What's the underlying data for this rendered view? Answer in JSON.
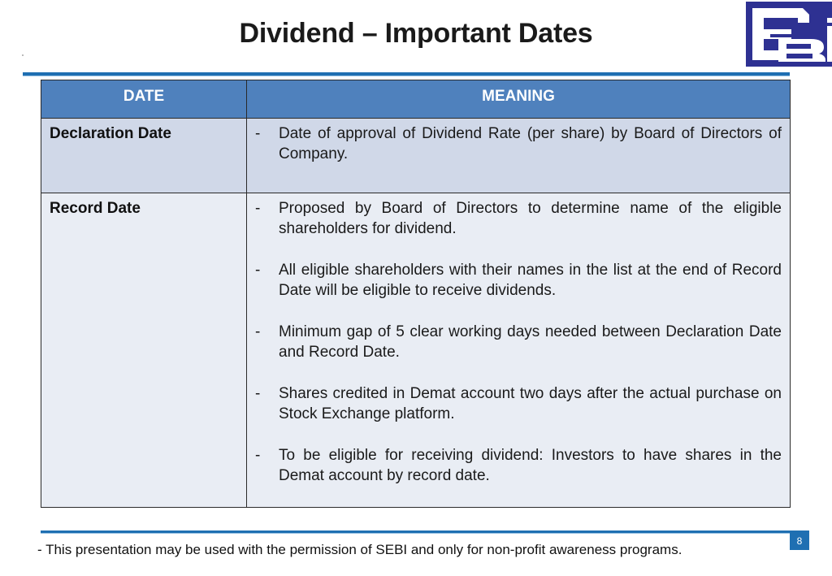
{
  "slide": {
    "title": "Dividend – Important Dates",
    "logo_text": "SEBI",
    "brand_color": "#1f6fb2",
    "header_color": "#4f81bd"
  },
  "table": {
    "headers": [
      "DATE",
      "MEANING"
    ],
    "rows": [
      {
        "date": "Declaration Date",
        "meanings": [
          "Date of approval of Dividend Rate (per share) by Board of Directors of Company."
        ]
      },
      {
        "date": "Record Date",
        "meanings": [
          "Proposed by Board of Directors to determine name of the eligible shareholders for dividend.",
          "All eligible shareholders with their names in the list at the end of Record Date will be eligible to receive dividends.",
          "Minimum gap of 5 clear working days needed between Declaration Date and Record Date.",
          "Shares credited in Demat account two days after the actual purchase on Stock Exchange platform.",
          "To be eligible for receiving dividend: Investors to have shares in the Demat account by record date."
        ]
      }
    ],
    "bullet_marker": "-"
  },
  "footer": {
    "disclaimer": "- This presentation may be used with the permission of SEBI and only for non-profit awareness programs.",
    "page_number": "8"
  }
}
